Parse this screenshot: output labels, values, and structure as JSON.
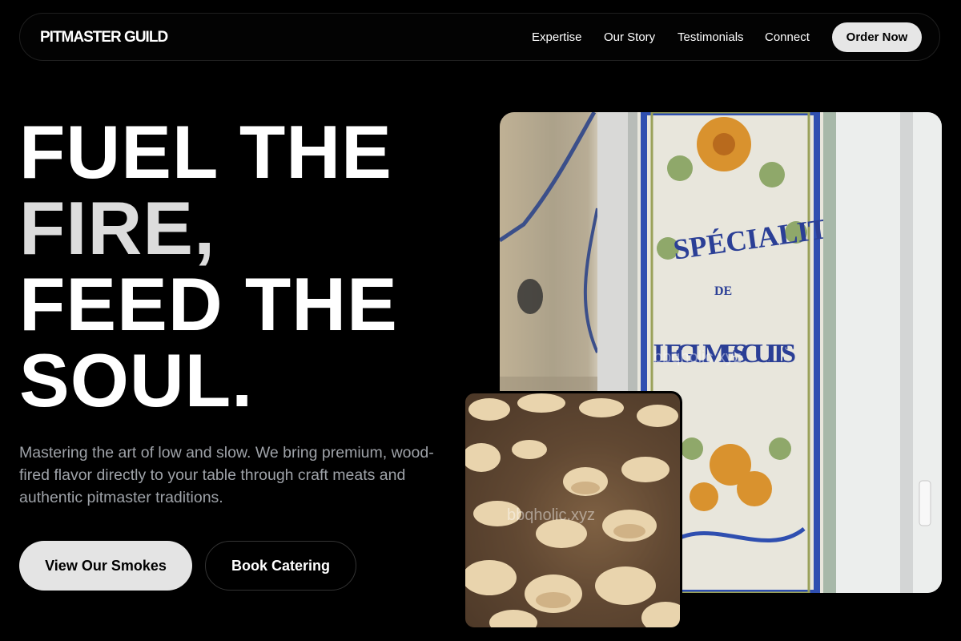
{
  "nav": {
    "brand": "PITMASTER GUILD",
    "links": [
      "Expertise",
      "Our Story",
      "Testimonials",
      "Connect"
    ],
    "cta": "Order Now"
  },
  "hero": {
    "headline_lines": [
      "FUEL THE",
      "FIRE,",
      "FEED THE",
      "SOUL."
    ],
    "subtext": "Mastering the art of low and slow. We bring premium, wood-fired flavor directly to your table through craft meats and authentic pitmaster traditions.",
    "primary_cta": "View Our Smokes",
    "secondary_cta": "Book Catering"
  },
  "images": {
    "main": {
      "sign_top": "SPÉCIALITÉ",
      "sign_mid": "DE",
      "sign_bottom": "LEGUMES CUITS",
      "watermark": "bbqholic.xyz"
    },
    "second": {
      "watermark": "bbqholic.xyz"
    }
  },
  "colors": {
    "background": "#000000",
    "text": "#ffffff",
    "muted_text": "#9ea2a8",
    "button_light": "#e4e4e4"
  }
}
